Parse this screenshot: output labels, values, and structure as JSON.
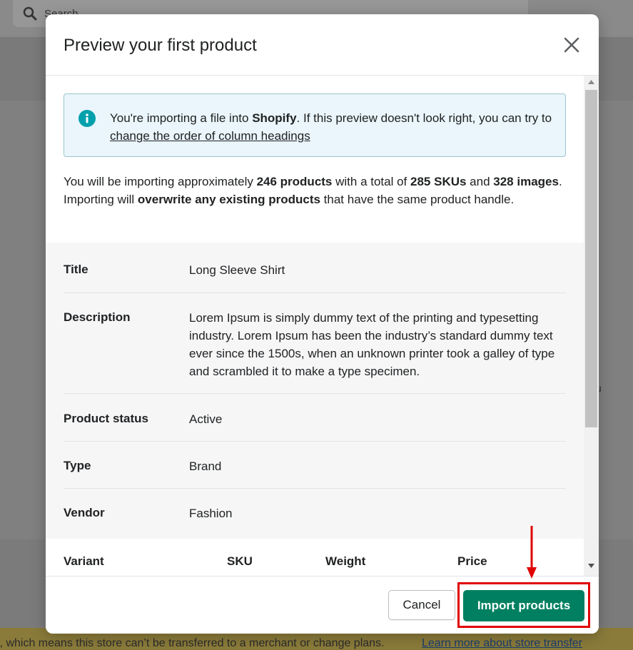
{
  "background": {
    "search_placeholder": "Search",
    "side_char": "u",
    "banner_text": "l, which means this store can’t be transferred to a merchant or change plans.",
    "banner_link": "Learn more about store transfer"
  },
  "modal": {
    "title": "Preview your first product",
    "info": {
      "text_1": "You're importing a file into ",
      "brand": "Shopify",
      "text_2": ". If this preview doesn't look right, you can try to ",
      "link": "change the order of column headings"
    },
    "summary": {
      "t1": "You will be importing approximately ",
      "products": "246 products",
      "t2": " with a total of ",
      "skus": "285 SKUs",
      "t3": " and ",
      "images": "328 images",
      "t4": ". Importing will ",
      "overwrite": "overwrite any existing products",
      "t5": " that have the same product handle."
    },
    "fields": [
      {
        "label": "Title",
        "value": "Long Sleeve Shirt"
      },
      {
        "label": "Description",
        "value": "Lorem Ipsum is simply dummy text of the printing and typesetting industry. Lorem Ipsum has been the industry’s standard dummy text ever since the 1500s, when an unknown printer took a galley of type and scrambled it to make a type specimen."
      },
      {
        "label": "Product status",
        "value": "Active"
      },
      {
        "label": "Type",
        "value": "Brand"
      },
      {
        "label": "Vendor",
        "value": "Fashion"
      }
    ],
    "variant_headers": [
      "Variant",
      "SKU",
      "Weight",
      "Price"
    ],
    "buttons": {
      "cancel": "Cancel",
      "import": "Import products"
    }
  },
  "colors": {
    "primary": "#008060",
    "annotation": "#e00000",
    "info_bg": "#eaf6fb",
    "info_icon": "#00a0ac"
  },
  "icons": [
    "search-icon",
    "close-icon",
    "info-icon",
    "arrow-down-icon"
  ]
}
